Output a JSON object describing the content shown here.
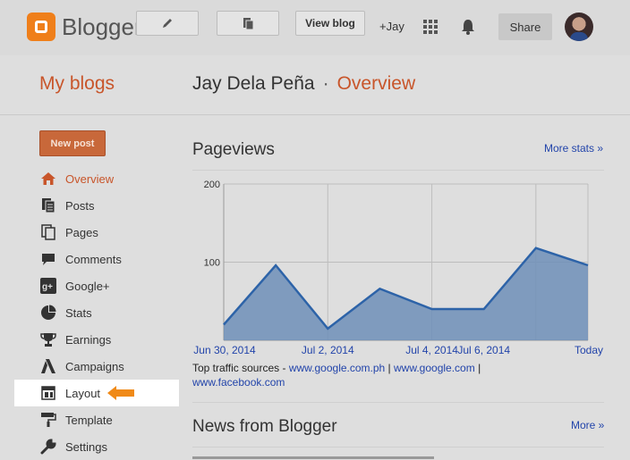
{
  "app": {
    "name": "Blogger"
  },
  "toolbar": {
    "view_blog": "View blog",
    "plus_user": "+Jay",
    "share": "Share"
  },
  "header": {
    "my_blogs": "My blogs",
    "blog_name": "Jay Dela Peña",
    "separator": "·",
    "page": "Overview"
  },
  "sidebar": {
    "new_post": "New post",
    "items": [
      {
        "label": "Overview",
        "icon": "home-icon"
      },
      {
        "label": "Posts",
        "icon": "posts-icon"
      },
      {
        "label": "Pages",
        "icon": "pages-icon"
      },
      {
        "label": "Comments",
        "icon": "comment-icon"
      },
      {
        "label": "Google+",
        "icon": "google-plus-icon"
      },
      {
        "label": "Stats",
        "icon": "pie-chart-icon"
      },
      {
        "label": "Earnings",
        "icon": "trophy-icon"
      },
      {
        "label": "Campaigns",
        "icon": "campaigns-icon"
      },
      {
        "label": "Layout",
        "icon": "layout-icon"
      },
      {
        "label": "Template",
        "icon": "paint-roller-icon"
      },
      {
        "label": "Settings",
        "icon": "wrench-icon"
      }
    ]
  },
  "pageviews": {
    "title": "Pageviews",
    "more_stats": "More stats »",
    "traffic_label": "Top traffic sources - ",
    "sources": [
      "www.google.com.ph",
      "www.google.com",
      "www.facebook.com"
    ],
    "sep": " | "
  },
  "news": {
    "title": "News from Blogger",
    "more": "More »"
  },
  "colors": {
    "accent": "#c8552a",
    "area": "#6f8fb8",
    "line": "#2d63a8",
    "arrow": "#f08a18"
  },
  "chart_data": {
    "type": "area",
    "x": [
      "Jun 30, 2014",
      "",
      "Jul 2, 2014",
      "",
      "Jul 4, 2014",
      "",
      "Jul 6, 2014",
      "",
      "Today"
    ],
    "values": [
      20,
      96,
      15,
      66,
      40,
      40,
      118,
      96
    ],
    "x_tick_labels": [
      "Jun 30, 2014",
      "Jul 2, 2014",
      "Jul 4, 2014",
      "Jul 6, 2014",
      "Today"
    ],
    "y_ticks": [
      100,
      200
    ],
    "ylim": [
      0,
      200
    ],
    "grid": true
  }
}
